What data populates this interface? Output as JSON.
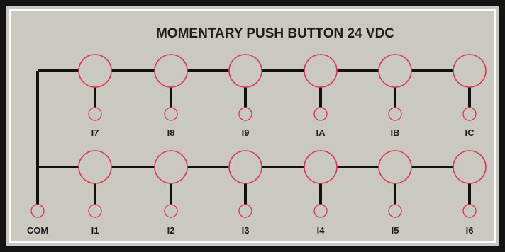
{
  "panel": {
    "title": "MOMENTARY PUSH BUTTON 24 VDC",
    "colors": {
      "panel_background": "#cbc8c2",
      "outer_frame": "#141414",
      "inner_border": "#ffffff",
      "wire": "#111111",
      "circle_outline": "#d93a56"
    }
  },
  "rows": [
    {
      "name": "top",
      "inputs": [
        {
          "label": "I7",
          "value": "I7"
        },
        {
          "label": "I8",
          "value": "I8"
        },
        {
          "label": "I9",
          "value": "I9"
        },
        {
          "label": "IA",
          "value": "IA"
        },
        {
          "label": "IB",
          "value": "IB"
        },
        {
          "label": "IC",
          "value": "IC"
        }
      ]
    },
    {
      "name": "bottom",
      "inputs": [
        {
          "label": "I1",
          "value": "I1"
        },
        {
          "label": "I2",
          "value": "I2"
        },
        {
          "label": "I3",
          "value": "I3"
        },
        {
          "label": "I4",
          "value": "I4"
        },
        {
          "label": "I5",
          "value": "I5"
        },
        {
          "label": "I6",
          "value": "I6"
        }
      ]
    }
  ],
  "common": {
    "label": "COM"
  }
}
